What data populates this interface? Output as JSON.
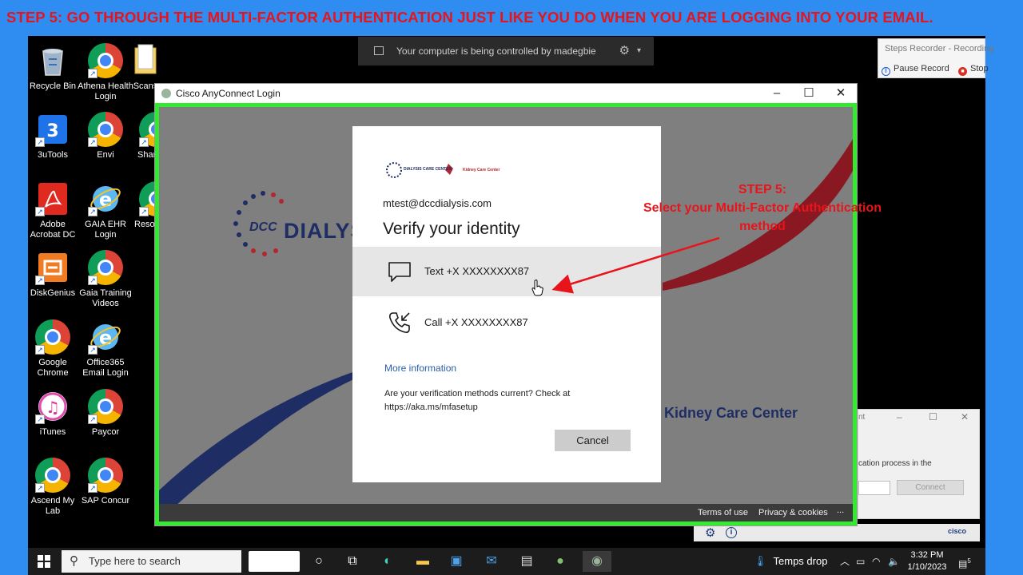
{
  "banner": {
    "text": "STEP 5: GO THROUGH THE MULTI-FACTOR AUTHENTICATION JUST LIKE YOU DO WHEN YOU ARE LOGGING INTO YOUR EMAIL."
  },
  "desktop_icons": [
    {
      "label": "Recycle Bin",
      "icon": "recycle-bin-icon"
    },
    {
      "label": "Athena Health Login",
      "icon": "chrome-icon"
    },
    {
      "label": "Scans",
      "icon": "folder-icon"
    },
    {
      "label": "3uTools",
      "icon": "3utools-icon"
    },
    {
      "label": "Envi",
      "icon": "chrome-icon"
    },
    {
      "label": "Shar",
      "icon": "chrome-icon"
    },
    {
      "label": "Adobe Acrobat DC",
      "icon": "adobe-acrobat-icon"
    },
    {
      "label": "GAIA EHR Login",
      "icon": "internet-explorer-icon"
    },
    {
      "label": "Reso",
      "icon": "chrome-icon"
    },
    {
      "label": "DiskGenius",
      "icon": "diskgenius-icon"
    },
    {
      "label": "Gaia Training Videos",
      "icon": "chrome-icon"
    },
    {
      "label": "Google Chrome",
      "icon": "chrome-icon"
    },
    {
      "label": "Office365 Email Login",
      "icon": "internet-explorer-icon"
    },
    {
      "label": "iTunes",
      "icon": "itunes-icon"
    },
    {
      "label": "Paycor",
      "icon": "chrome-icon"
    },
    {
      "label": "Ascend My Lab",
      "icon": "chrome-icon"
    },
    {
      "label": "SAP Concur",
      "icon": "chrome-icon"
    }
  ],
  "remote_bar": {
    "text": "Your computer is being controlled by madegbie"
  },
  "steps_recorder": {
    "title": "Steps Recorder - Recording",
    "pause": "Pause Record",
    "stop": "Stop"
  },
  "window": {
    "title": "Cisco AnyConnect Login",
    "minimize": "–",
    "maximize": "☐",
    "close": "✕"
  },
  "background": {
    "dcc": "DCC",
    "dialysis": "DIALYSI",
    "kidney": "Kidney Care Center"
  },
  "card": {
    "logo_text_1": "DIALYSIS CARE CENTER",
    "logo_text_2": "Kidney Care Center",
    "email": "mtest@dccdialysis.com",
    "title": "Verify your identity",
    "options": [
      {
        "label": "Text +X XXXXXXXX87",
        "icon": "chat-bubble-icon"
      },
      {
        "label": "Call +X XXXXXXXX87",
        "icon": "phone-icon"
      }
    ],
    "more_info": "More information",
    "mfa_question": "Are your verification methods current? Check at https://aka.ms/mfasetup",
    "cancel": "Cancel"
  },
  "footer": {
    "terms": "Terms of use",
    "privacy": "Privacy & cookies",
    "more": "..."
  },
  "annotation": {
    "line1": "STEP 5:",
    "line2": "Select your Multi-Factor Authentication method"
  },
  "sub_dialog": {
    "title_frag": "nt",
    "text": "cation process in the",
    "connect": "Connect"
  },
  "cisco_bar": {
    "logo": "cisco"
  },
  "taskbar": {
    "search_placeholder": "Type here to search",
    "weather": "Temps drop",
    "time": "3:32 PM",
    "date": "1/10/2023",
    "notif_count": "5"
  },
  "colors": {
    "accent_red": "#e8141b",
    "frame_green": "#35e831",
    "banner_blue": "#2f8cf0"
  }
}
